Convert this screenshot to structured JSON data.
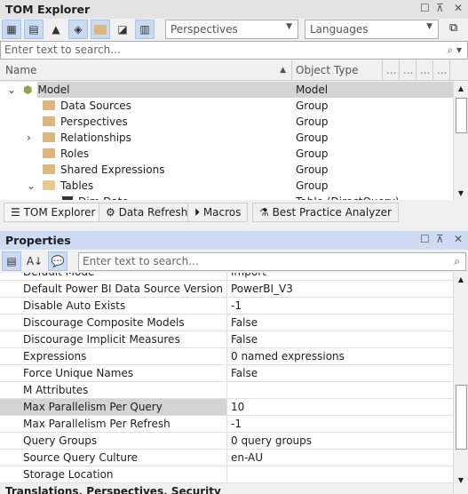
{
  "tom": {
    "title": "TOM Explorer",
    "perspectives": "Perspectives",
    "languages": "Languages",
    "search_placeholder": "Enter text to search...",
    "columns": {
      "name": "Name",
      "type": "Object Type",
      "extra": [
        "...",
        "...",
        "...",
        "..."
      ]
    },
    "tree": [
      {
        "name": "Model",
        "type": "Model",
        "level": 0,
        "expand": "⌄",
        "icon": "model"
      },
      {
        "name": "Data Sources",
        "type": "Group",
        "level": 1,
        "expand": "",
        "icon": "folder"
      },
      {
        "name": "Perspectives",
        "type": "Group",
        "level": 1,
        "expand": "",
        "icon": "folder"
      },
      {
        "name": "Relationships",
        "type": "Group",
        "level": 1,
        "expand": "›",
        "icon": "folder"
      },
      {
        "name": "Roles",
        "type": "Group",
        "level": 1,
        "expand": "",
        "icon": "folder"
      },
      {
        "name": "Shared Expressions",
        "type": "Group",
        "level": 1,
        "expand": "",
        "icon": "folder"
      },
      {
        "name": "Tables",
        "type": "Group",
        "level": 1,
        "expand": "⌄",
        "icon": "folder-open"
      },
      {
        "name": "Dim Date",
        "type": "Table (DirectQuery)",
        "level": 2,
        "expand": "",
        "icon": "table"
      }
    ]
  },
  "tabs": [
    "TOM Explorer",
    "Data Refresh",
    "Macros",
    "Best Practice Analyzer"
  ],
  "props": {
    "title": "Properties",
    "search_placeholder": "Enter text to search...",
    "rows": [
      {
        "k": "Default Mode",
        "v": "Import"
      },
      {
        "k": "Default Power BI Data Source Version",
        "v": "PowerBI_V3"
      },
      {
        "k": "Disable Auto Exists",
        "v": "-1"
      },
      {
        "k": "Discourage Composite Models",
        "v": "False"
      },
      {
        "k": "Discourage Implicit Measures",
        "v": "False"
      },
      {
        "k": "Expressions",
        "v": "0 named expressions"
      },
      {
        "k": "Force Unique Names",
        "v": "False"
      },
      {
        "k": "M Attributes",
        "v": ""
      },
      {
        "k": "Max Parallelism Per Query",
        "v": "10",
        "selected": true
      },
      {
        "k": "Max Parallelism Per Refresh",
        "v": "-1"
      },
      {
        "k": "Query Groups",
        "v": "0 query groups"
      },
      {
        "k": "Source Query Culture",
        "v": "en-AU"
      },
      {
        "k": "Storage Location",
        "v": ""
      }
    ],
    "next_category": "Translations, Perspectives, Security"
  },
  "colors": {
    "selected_row": "#d4d4d4",
    "active_header": "#cddcf2",
    "toolbar_on": "#c9daf3"
  }
}
